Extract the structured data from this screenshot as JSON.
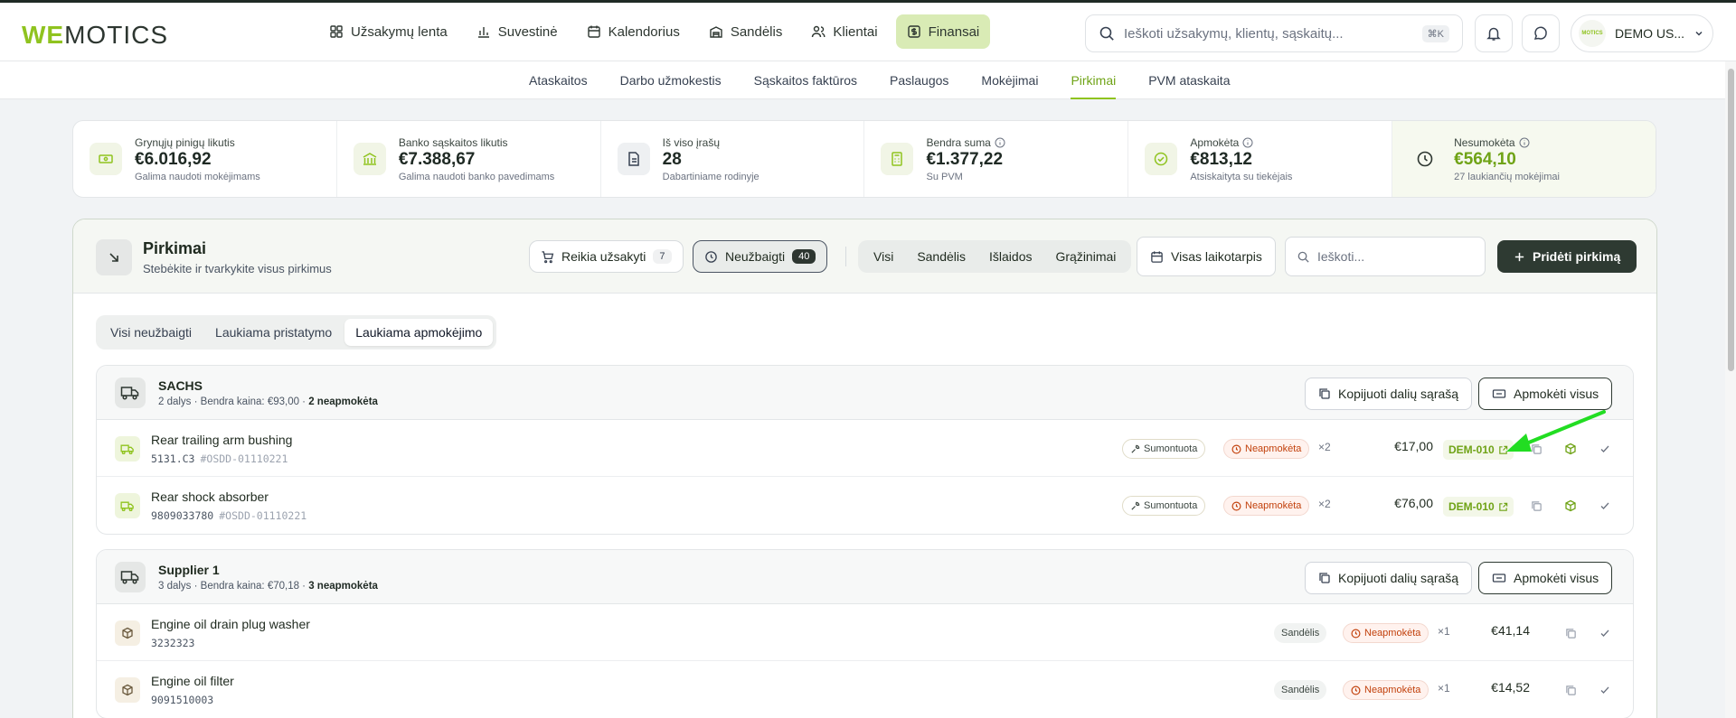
{
  "logo": {
    "we": "WE",
    "rest": "MOTICS"
  },
  "nav": [
    {
      "label": "Užsakymų lenta",
      "icon": "grid-icon",
      "active": false
    },
    {
      "label": "Suvestinė",
      "icon": "bar-chart-icon",
      "active": false
    },
    {
      "label": "Kalendorius",
      "icon": "calendar-icon",
      "active": false
    },
    {
      "label": "Sandėlis",
      "icon": "warehouse-icon",
      "active": false
    },
    {
      "label": "Klientai",
      "icon": "users-icon",
      "active": false
    },
    {
      "label": "Finansai",
      "icon": "dollar-icon",
      "active": true
    }
  ],
  "search": {
    "placeholder": "Ieškoti užsakymų, klientų, sąskaitų...",
    "shortcut": "⌘K"
  },
  "user": {
    "name": "DEMO US..."
  },
  "subnav": [
    "Ataskaitos",
    "Darbo užmokestis",
    "Sąskaitos faktūros",
    "Paslaugos",
    "Mokėjimai",
    "Pirkimai",
    "PVM ataskaita"
  ],
  "subnav_active": "Pirkimai",
  "stats": [
    {
      "label": "Grynųjų pinigų likutis",
      "value": "€6.016,92",
      "sub": "Galima naudoti mokėjimams",
      "icon": "cash-icon"
    },
    {
      "label": "Banko sąskaitos likutis",
      "value": "€7.388,67",
      "sub": "Galima naudoti banko pavedimams",
      "icon": "bank-icon"
    },
    {
      "label": "Iš viso įrašų",
      "value": "28",
      "sub": "Dabartiniame rodinyje",
      "icon": "document-icon"
    },
    {
      "label": "Bendra suma",
      "value": "€1.377,22",
      "sub": "Su PVM",
      "icon": "calculator-icon"
    },
    {
      "label": "Apmokėta",
      "value": "€813,12",
      "sub": "Atsiskaityta su tiekėjais",
      "icon": "check-circle-icon"
    },
    {
      "label": "Nesumokėta",
      "value": "€564,10",
      "sub": "27 laukiančių mokėjimai",
      "icon": "clock-icon"
    }
  ],
  "panel": {
    "title": "Pirkimai",
    "subtitle": "Stebėkite ir tvarkykite visus pirkimus",
    "needs_order": {
      "label": "Reikia užsakyti",
      "count": "7"
    },
    "unfinished": {
      "label": "Neužbaigti",
      "count": "40"
    },
    "segments": [
      "Visi",
      "Sandėlis",
      "Išlaidos",
      "Grąžinimai"
    ],
    "period": "Visas laikotarpis",
    "search_placeholder": "Ieškoti...",
    "add_label": "Pridėti pirkimą",
    "tabs": [
      "Visi neužbaigti",
      "Laukiama pristatymo",
      "Laukiama apmokėjimo"
    ],
    "active_tab": "Laukiama apmokėjimo"
  },
  "groups": [
    {
      "name": "SACHS",
      "meta_prefix": "2 dalys · Bendra kaina: €93,00 · ",
      "meta_unpaid": "2 neapmokėta",
      "copy_label": "Kopijuoti dalių sąrašą",
      "pay_label": "Apmokėti visus",
      "rows": [
        {
          "name": "Rear trailing arm bushing",
          "code": "5131.C3",
          "ref": "#OSDD-01110221",
          "status": "Sumontuota",
          "payment": "Neapmokėta",
          "qty": "×2",
          "price": "€17,00",
          "order": "DEM-010"
        },
        {
          "name": "Rear shock absorber",
          "code": "9809033780",
          "ref": "#OSDD-01110221",
          "status": "Sumontuota",
          "payment": "Neapmokėta",
          "qty": "×2",
          "price": "€76,00",
          "order": "DEM-010"
        }
      ]
    },
    {
      "name": "Supplier 1",
      "meta_prefix": "3 dalys · Bendra kaina: €70,18 · ",
      "meta_unpaid": "3 neapmokėta",
      "copy_label": "Kopijuoti dalių sąrašą",
      "pay_label": "Apmokėti visus",
      "rows": [
        {
          "name": "Engine oil drain plug washer",
          "code": "3232323",
          "ref": "",
          "status": "Sandėlis",
          "payment": "Neapmokėta",
          "qty": "×1",
          "price": "€41,14",
          "order": ""
        },
        {
          "name": "Engine oil filter",
          "code": "9091510003",
          "ref": "",
          "status": "Sandėlis",
          "payment": "Neapmokėta",
          "qty": "×1",
          "price": "€14,52",
          "order": ""
        }
      ]
    }
  ],
  "colors": {
    "accent": "#8fc31f",
    "dark": "#2e3a32",
    "unpaid": "#c2410c",
    "annotation_arrow": "#22dd22"
  }
}
